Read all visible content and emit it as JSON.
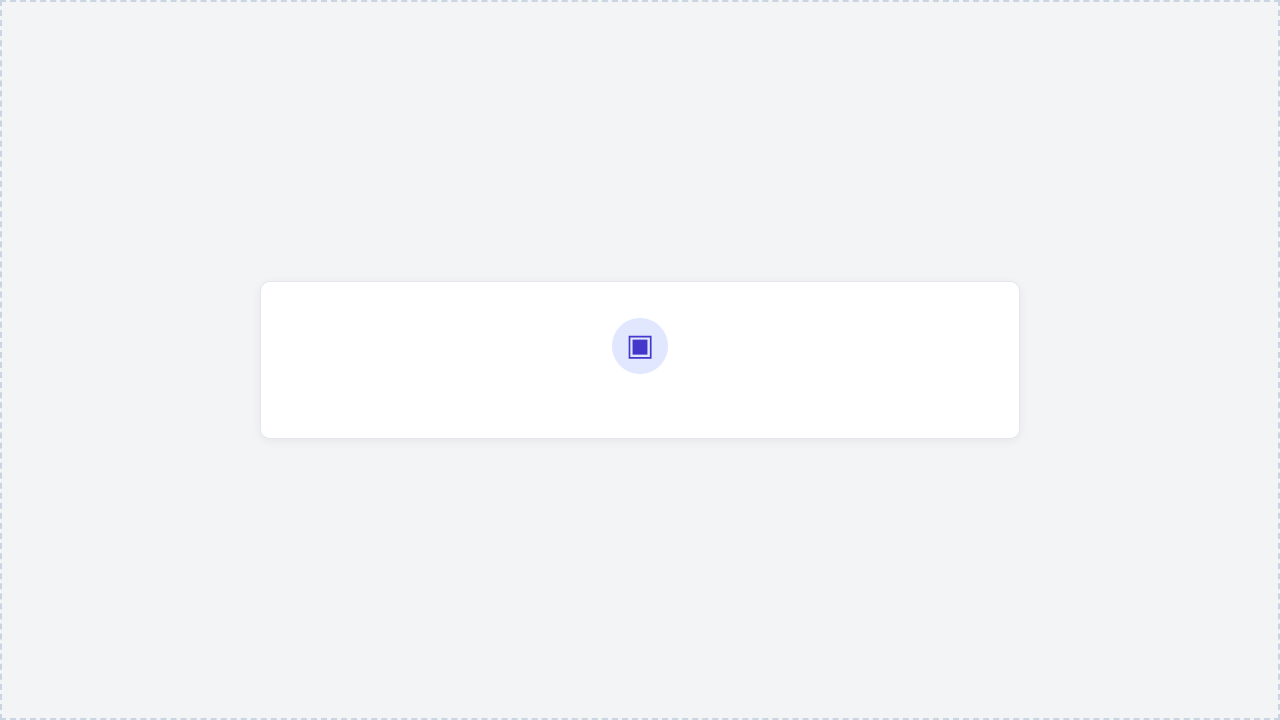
{
  "screenshot": {
    "title": "",
    "message": ""
  }
}
